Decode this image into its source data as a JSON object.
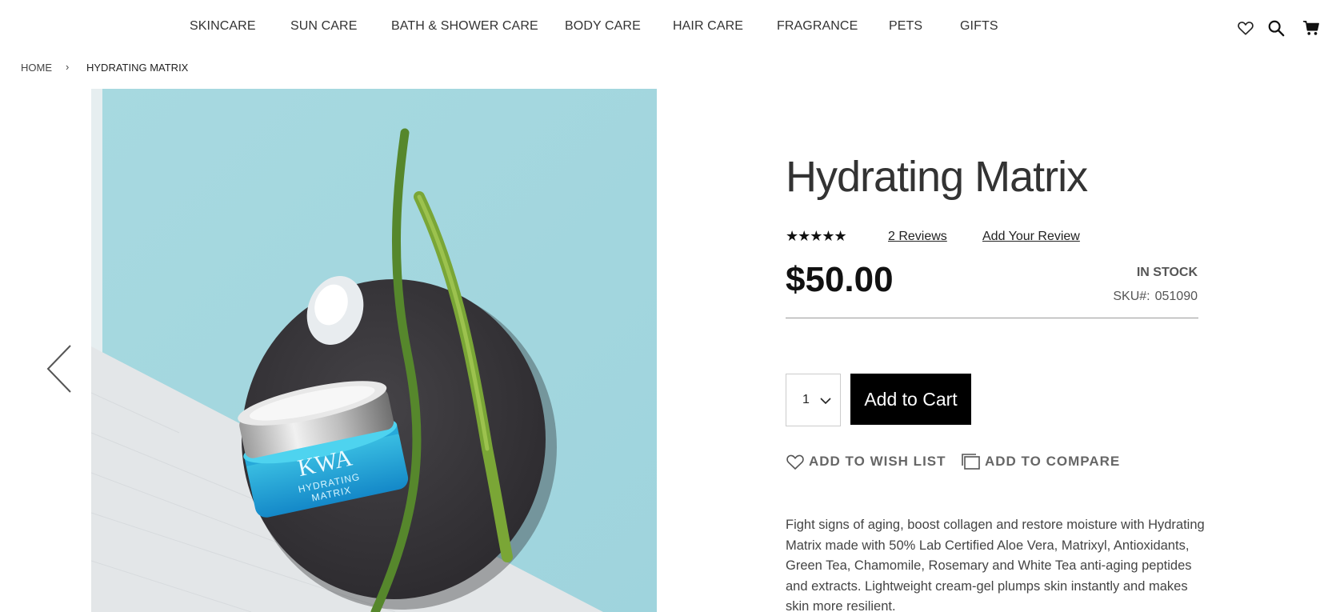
{
  "nav": {
    "categories": [
      "SKINCARE",
      "SUN CARE",
      "BATH & SHOWER CARE",
      "BODY CARE",
      "HAIR CARE",
      "FRAGRANCE",
      "PETS",
      "GIFTS"
    ],
    "icons": [
      "heart-icon",
      "search-icon",
      "cart-icon"
    ]
  },
  "breadcrumb": {
    "home": "HOME",
    "separator": "›",
    "current": "HYDRATING MATRIX"
  },
  "product": {
    "title": "Hydrating Matrix",
    "stars": "★★★★★",
    "rating": 5,
    "reviews_link": "2  Reviews",
    "add_review_link": "Add Your Review",
    "price": "$50.00",
    "stock": "IN STOCK",
    "sku_label": "SKU#:",
    "sku_value": "051090",
    "qty": "1",
    "add_to_cart": "Add to Cart",
    "wishlist": "ADD TO WISH LIST",
    "compare": "ADD TO COMPARE",
    "description": "Fight signs of aging, boost collagen and restore moisture with Hydrating Matrix made with 50% Lab Certified Aloe Vera, Matrixyl, Antioxidants, Green Tea, Chamomile, Rosemary and White Tea anti-aging peptides and extracts. Lightweight cream-gel plumps skin instantly and makes skin more resilient.",
    "jar_brand": "KWA",
    "jar_label_1": "HYDRATING",
    "jar_label_2": "MATRIX"
  },
  "colors": {
    "accent": "#000000",
    "image_background": "#a8dbe3"
  }
}
